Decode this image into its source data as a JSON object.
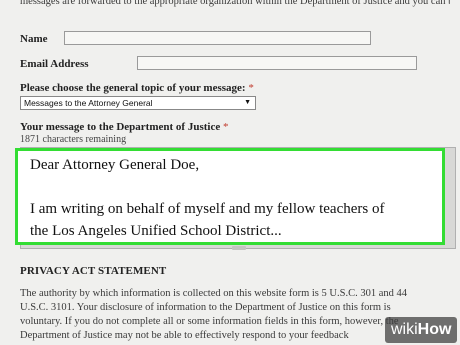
{
  "intro": {
    "text": "messages are forwarded to the appropriate organization within the Department of Justice and you can be assured that your voices and views are being heard."
  },
  "form": {
    "name_label": "Name",
    "name_value": "",
    "email_label": "Email Address",
    "email_value": "",
    "topic_label": "Please choose the general topic of your message:",
    "topic_required_mark": "*",
    "topic_selected": "Messages to the Attorney General",
    "topic_arrow": "▼",
    "message_label": "Your message to the Department of Justice",
    "message_required_mark": "*",
    "characters_remaining": "1871 characters remaining",
    "message_lines": [
      "Dear Attorney General Doe,",
      "",
      "I am writing on behalf of myself and my fellow teachers of",
      "the Los Angeles Unified School District..."
    ]
  },
  "privacy": {
    "heading": "PRIVACY ACT STATEMENT",
    "lines": [
      "The authority by which information is collected on this website form is 5 U.S.C. 301 and 44",
      "U.S.C. 3101.  Your disclosure of information to the Department of Justice on this form is",
      "voluntary.  If you do not complete all or some information fields in this form, however, the",
      "Department of Justice may not be able to effectively respond to your feedback"
    ]
  },
  "watermark": {
    "wiki": "wiki",
    "how": "How"
  },
  "colors": {
    "highlight_border": "#33dd33",
    "required_mark": "#c0392b",
    "background": "#f0f0ee"
  }
}
